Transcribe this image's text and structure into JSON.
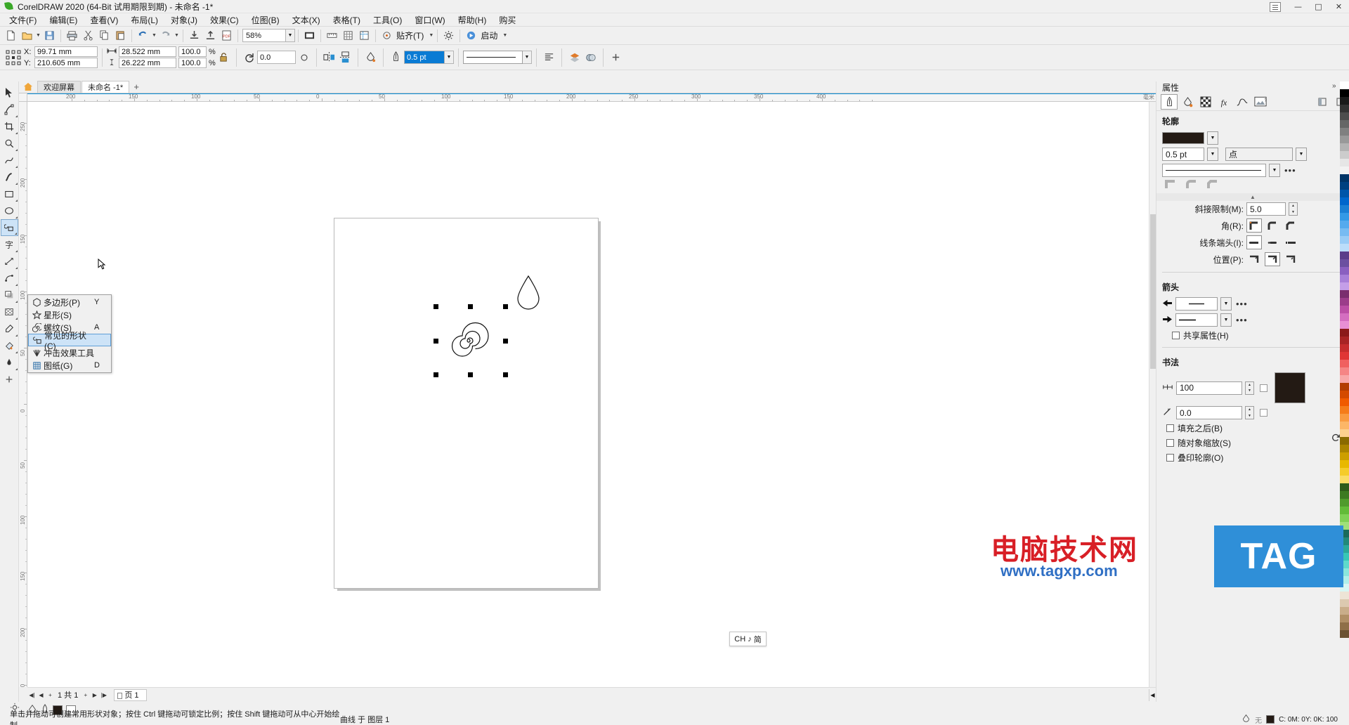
{
  "window": {
    "title": "CorelDRAW 2020 (64-Bit 试用期限到期) - 未命名 -1*",
    "minimize": "—",
    "maximize": "▢",
    "close": "✕"
  },
  "menubar": {
    "items": [
      {
        "label": "文件(F)"
      },
      {
        "label": "编辑(E)"
      },
      {
        "label": "查看(V)"
      },
      {
        "label": "布局(L)"
      },
      {
        "label": "对象(J)"
      },
      {
        "label": "效果(C)"
      },
      {
        "label": "位图(B)"
      },
      {
        "label": "文本(X)"
      },
      {
        "label": "表格(T)"
      },
      {
        "label": "工具(O)"
      },
      {
        "label": "窗口(W)"
      },
      {
        "label": "帮助(H)"
      },
      {
        "label": "购买"
      }
    ]
  },
  "toolbar": {
    "zoom_value": "58%",
    "snap_label": "贴齐(T)",
    "launch_label": "启动"
  },
  "propertybar": {
    "x_key": "X:",
    "y_key": "Y:",
    "x_value": "99.71 mm",
    "y_value": "210.605 mm",
    "width_value": "28.522 mm",
    "height_value": "26.222 mm",
    "scale_x": "100.0",
    "scale_y": "100.0",
    "percent": "%",
    "rotation": "0.0",
    "outline_width": "0.5 pt"
  },
  "tabs": {
    "welcome": "欢迎屏幕",
    "document": "未命名 -1*",
    "new_tab": "+"
  },
  "flyout": {
    "items": [
      {
        "icon": "polygon-icon",
        "label": "多边形(P)",
        "key": "Y",
        "selected": false
      },
      {
        "icon": "star-icon",
        "label": "星形(S)",
        "key": "",
        "selected": false
      },
      {
        "icon": "spiral-icon",
        "label": "螺纹(S)",
        "key": "A",
        "selected": false
      },
      {
        "icon": "common-shapes-icon",
        "label": "常见的形状(C)",
        "key": "",
        "selected": true
      },
      {
        "icon": "impact-tool-icon",
        "label": "冲击效果工具",
        "key": "",
        "selected": false
      },
      {
        "icon": "graph-paper-icon",
        "label": "图纸(G)",
        "key": "D",
        "selected": false
      }
    ]
  },
  "docker": {
    "title": "属性",
    "tabs": [
      {
        "name": "outline-tab",
        "active": true
      },
      {
        "name": "fill-tab",
        "active": false
      },
      {
        "name": "transparency-tab",
        "active": false
      },
      {
        "name": "effects-tab",
        "active": false
      },
      {
        "name": "curve-tab",
        "active": false
      },
      {
        "name": "bitmap-tab",
        "active": false
      }
    ],
    "outline": {
      "section_title": "轮廓",
      "color": "#231a14",
      "width_value": "0.5 pt",
      "unit_value": "点",
      "miter_label": "斜接限制(M):",
      "miter_value": "5.0",
      "corner_label": "角(R):",
      "linecap_label": "线条端头(I):",
      "position_label": "位置(P):",
      "more_dots": "•••"
    },
    "arrows": {
      "section_title": "箭头",
      "share_attributes_label": "共享属性(H)",
      "dots": "•••"
    },
    "calligraphy": {
      "section_title": "书法",
      "stretch_value": "100",
      "angle_value": "0.0",
      "color": "#231a14",
      "behind_fill_label": "填充之后(B)",
      "scale_with_object_label": "随对象缩放(S)",
      "overprint_label": "叠印轮廓(O)"
    }
  },
  "rulers": {
    "unit": "毫米",
    "h_ticks": [
      "200",
      "150",
      "100",
      "50",
      "0",
      "50",
      "100",
      "150",
      "200",
      "250",
      "300",
      "350",
      "400"
    ],
    "v_ticks": [
      "250",
      "200",
      "150",
      "100",
      "50",
      "0",
      "50",
      "100",
      "150",
      "200",
      "250"
    ]
  },
  "pagebar": {
    "page_indicator": "1 共 1",
    "page_tab": "页 1",
    "add": "+"
  },
  "statusbar": {
    "hint": "单击并拖动可创建常用形状对象；按住 Ctrl 键拖动可锁定比例；按住 Shift 键拖动可从中心开始绘制",
    "object_info": "曲线 于 图层 1",
    "fill_none": "无",
    "color_info": "C: 0M:  0Y:  0K: 100"
  },
  "ime": {
    "lang": "CH",
    "mode": "简",
    "note": "♪"
  },
  "watermark": {
    "cn_text": "电脑技术网",
    "url_text": "www.tagxp.com",
    "tag_text": "TAG",
    "cn_color": "#d81f26",
    "url_color": "#2f6fc4",
    "tag_bg": "#2f8fd8"
  },
  "colors": {
    "accent": "#0a8fd8",
    "selection_blue": "#cde3f7",
    "chrome": "#f0f0f0"
  }
}
